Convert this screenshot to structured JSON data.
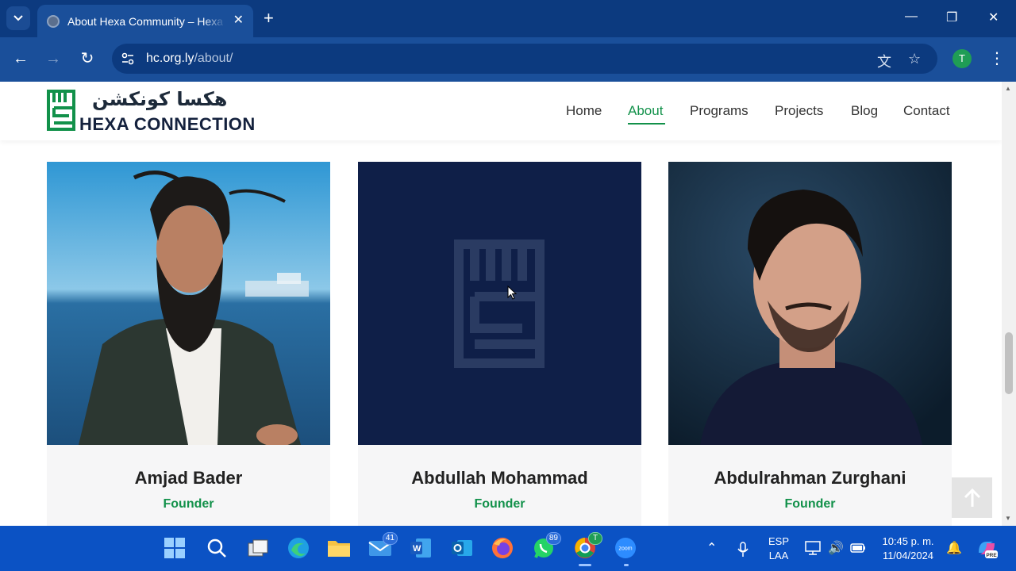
{
  "browser": {
    "tab_title": "About Hexa Community – Hexa Connection",
    "url_host": "hc.org.ly",
    "url_path": "/about/",
    "profile_initial": "T",
    "new_tab": "+",
    "tab_close": "✕"
  },
  "site": {
    "logo_arabic": "هكسا كونكشن",
    "logo_latin": "HEXA CONNECTION",
    "menu": [
      "Home",
      "About",
      "Programs",
      "Projects",
      "Blog",
      "Contact"
    ],
    "active_menu": "About",
    "accent_color": "#12914a"
  },
  "team": [
    {
      "name": "Amjad Bader",
      "role": "Founder"
    },
    {
      "name": "Abdullah Mohammad",
      "role": "Founder"
    },
    {
      "name": "Abdulrahman Zurghani",
      "role": "Founder"
    }
  ],
  "taskbar": {
    "mail_badge": "41",
    "whatsapp_badge": "89",
    "chrome_badge": "T",
    "zoom_label": "zoom",
    "language_top": "ESP",
    "language_bottom": "LAA",
    "time": "10:45 p. m.",
    "date": "11/04/2024",
    "copilot_label": "PRE"
  }
}
